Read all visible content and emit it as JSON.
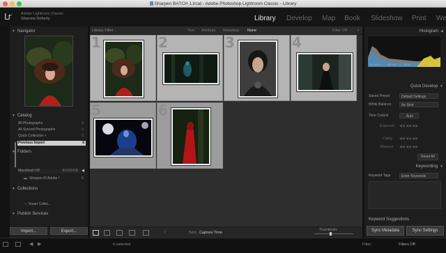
{
  "window": {
    "title": "Sharpen BATCH 1.lrcat - Adobe Photoshop Lightroom Classic - Library"
  },
  "identity": {
    "logo": "Lr",
    "line1": "Adobe Lightroom Classic",
    "line2": "Sharona Doherty"
  },
  "modules": [
    "Library",
    "Develop",
    "Map",
    "Book",
    "Slideshow",
    "Print",
    "We"
  ],
  "left": {
    "navigator": "Navigator",
    "catalog": {
      "title": "Catalog",
      "items": [
        {
          "label": "All Photographs",
          "count": "6"
        },
        {
          "label": "All Synced Photographs",
          "count": "0"
        },
        {
          "label": "Quick Collection +",
          "count": "0"
        },
        {
          "label": "Previous Import",
          "count": "6"
        }
      ]
    },
    "folders": {
      "title": "Folders",
      "drive": "Macintosh HD",
      "drive_space": "83/250GB",
      "folder": "Sharpen AI Adobe I",
      "folder_count": "6"
    },
    "collections": {
      "title": "Collections",
      "item": "Smart Collec..."
    },
    "publish": {
      "title": "Publish Services"
    },
    "import_btn": "Import...",
    "export_btn": "Export..."
  },
  "filter": {
    "label": "Library Filter :",
    "options": [
      "Text",
      "Attribute",
      "Metadata",
      "None"
    ],
    "active": "None",
    "off": "Filter Off"
  },
  "grid": {
    "numbers": [
      "1",
      "2",
      "3",
      "4",
      "5",
      "6"
    ]
  },
  "toolbar": {
    "sort_label": "Sort:",
    "sort_value": "Capture Time",
    "thumbnails_label": "Thumbnails"
  },
  "right": {
    "histogram": "Histogram",
    "histogram_meta": [
      "ISO 800",
      "45 mm",
      "f/5.6",
      "1/125"
    ],
    "quick_develop": "Quick Develop",
    "saved_preset_label": "Saved Preset",
    "saved_preset_value": "Default Settings",
    "white_balance_label": "White Balance",
    "white_balance_value": "As Shot",
    "tone_control_label": "Tone Control",
    "tone_control_value": "Auto",
    "exposure_label": "Exposure",
    "clarity_label": "Clarity",
    "vibrance_label": "Vibrance",
    "reset_all": "Reset All",
    "keywording": "Keywording",
    "keyword_tags_label": "Keyword Tags",
    "keyword_tags_value": "Enter Keywords",
    "keyword_suggestions": "Keyword Suggestions",
    "sync_metadata": "Sync Metadata",
    "sync_settings": "Sync Settings"
  },
  "filmstrip": {
    "selected": "6 selected",
    "filter": "Filter:",
    "filters_off": "Filters Off"
  },
  "colors": {
    "accent_active": "#e8e8e8",
    "panel_bg": "#1e1e1e",
    "grid_cell": "#b4b4b4"
  }
}
